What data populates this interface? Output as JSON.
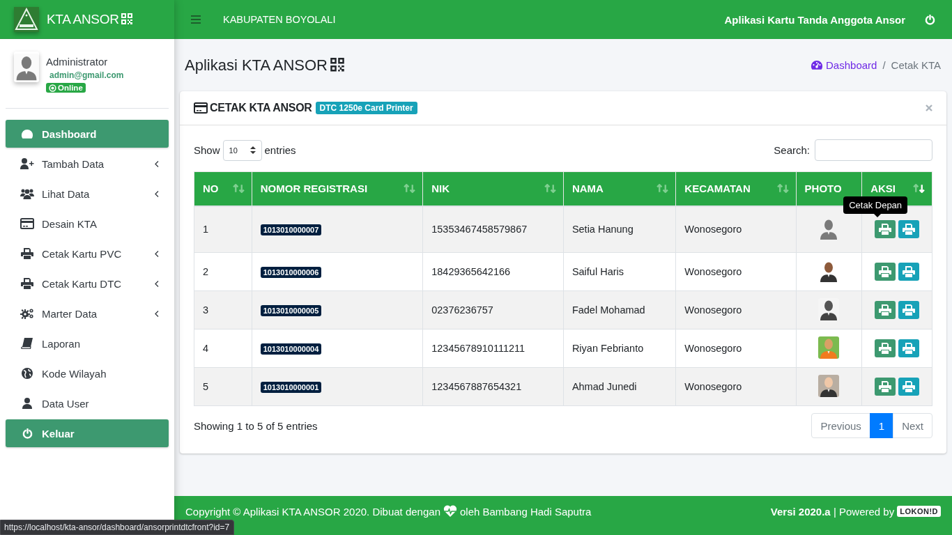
{
  "brand": {
    "title": "KTA ANSOR"
  },
  "topbar": {
    "region": "KABUPATEN BOYOLALI",
    "app_name": "Aplikasi Kartu Tanda Anggota Ansor"
  },
  "user": {
    "name": "Administrator",
    "email": "admin@gmail.com",
    "status": "Online"
  },
  "sidebar": {
    "items": [
      {
        "label": "Dashboard",
        "kind": "link",
        "selected": true,
        "has_submenu": false
      },
      {
        "label": "Tambah Data",
        "kind": "link",
        "selected": false,
        "has_submenu": true
      },
      {
        "label": "Lihat Data",
        "kind": "link",
        "selected": false,
        "has_submenu": true
      },
      {
        "label": "Desain KTA",
        "kind": "link",
        "selected": false,
        "has_submenu": false
      },
      {
        "label": "Cetak Kartu PVC",
        "kind": "link",
        "selected": false,
        "has_submenu": true
      },
      {
        "label": "Cetak Kartu DTC",
        "kind": "link",
        "selected": false,
        "has_submenu": true
      },
      {
        "label": "Marter Data",
        "kind": "link",
        "selected": false,
        "has_submenu": true
      },
      {
        "label": "Laporan",
        "kind": "link",
        "selected": false,
        "has_submenu": false
      },
      {
        "label": "Kode Wilayah",
        "kind": "link",
        "selected": false,
        "has_submenu": false
      },
      {
        "label": "Data User",
        "kind": "link",
        "selected": false,
        "has_submenu": false
      }
    ],
    "logout": {
      "label": "Keluar"
    }
  },
  "page": {
    "title": "Aplikasi KTA ANSOR",
    "breadcrumb_separator": "/",
    "breadcrumb": [
      {
        "label": "Dashboard",
        "kind": "link"
      },
      {
        "label": "Cetak KTA",
        "kind": "current"
      }
    ]
  },
  "card": {
    "title": "CETAK KTA ANSOR",
    "badge": "DTC 1250e Card Printer",
    "length": {
      "before": "Show",
      "value": "10",
      "after": "entries"
    },
    "search": {
      "label": "Search:"
    },
    "table": {
      "columns": [
        {
          "label": "NO",
          "sortable": true,
          "sorted_desc": false
        },
        {
          "label": "NOMOR REGISTRASI",
          "sortable": true,
          "sorted_desc": false
        },
        {
          "label": "NIK",
          "sortable": true,
          "sorted_desc": false
        },
        {
          "label": "NAMA",
          "sortable": true,
          "sorted_desc": false
        },
        {
          "label": "KECAMATAN",
          "sortable": true,
          "sorted_desc": false
        },
        {
          "label": "PHOTO",
          "sortable": false
        },
        {
          "label": "AKSI",
          "sortable": true,
          "sorted_desc": true
        }
      ],
      "rows": [
        {
          "no": "1",
          "registration": "1013010000007",
          "nik": "15353467458579867",
          "name": "Setia Hanung",
          "district": "Wonosegoro",
          "tooltip": "Cetak Depan"
        },
        {
          "no": "2",
          "registration": "1013010000006",
          "nik": "18429365642166",
          "name": "Saiful Haris",
          "district": "Wonosegoro"
        },
        {
          "no": "3",
          "registration": "1013010000005",
          "nik": "02376236757",
          "name": "Fadel Mohamad",
          "district": "Wonosegoro"
        },
        {
          "no": "4",
          "registration": "1013010000004",
          "nik": "12345678910111211",
          "name": "Riyan Febrianto",
          "district": "Wonosegoro"
        },
        {
          "no": "5",
          "registration": "1013010000001",
          "nik": "1234567887654321",
          "name": "Ahmad Junedi",
          "district": "Wonosegoro"
        }
      ]
    },
    "info": "Showing 1 to 5 of 5 entries",
    "pagination": [
      {
        "label": "Previous",
        "selected": false
      },
      {
        "label": "1",
        "selected": true
      },
      {
        "label": "Next",
        "selected": false
      }
    ]
  },
  "footer": {
    "copyright": "Copyright © Aplikasi KTA ANSOR 2020. Dibuat dengan",
    "author": "oleh Bambang Hadi Saputra",
    "version": "**Versi 2020.a** | Powered by",
    "powered_badge": "LOKON!D"
  },
  "status_bar": {
    "url": "https://localhost/kta-ansor/dashboard/ansorprintdtcfront?id=7"
  }
}
